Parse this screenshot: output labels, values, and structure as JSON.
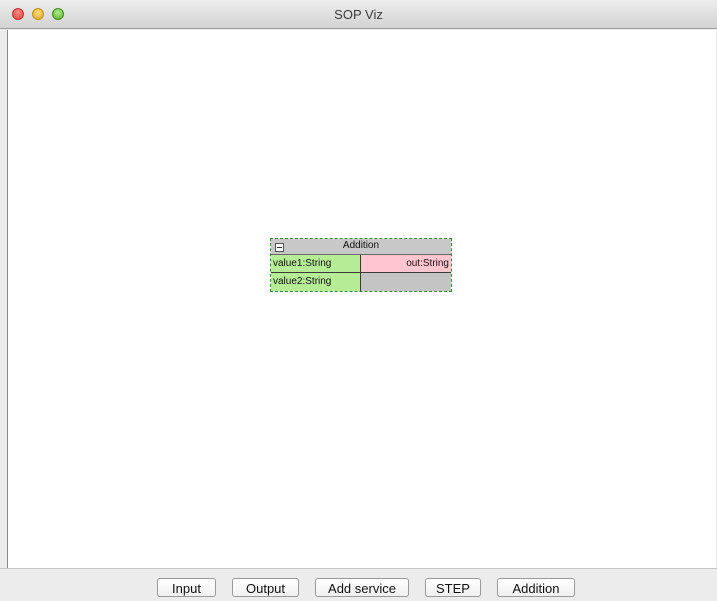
{
  "window": {
    "title": "SOP Viz"
  },
  "node": {
    "title": "Addition",
    "inputs": [
      "value1:String",
      "value2:String"
    ],
    "outputs": [
      "out:String"
    ]
  },
  "toolbar": {
    "buttons": [
      "Input",
      "Output",
      "Add service",
      "STEP",
      "Addition"
    ]
  },
  "colors": {
    "input_port": "#b7ec97",
    "output_port": "#ffc6cf",
    "node_header": "#c8c8c8"
  }
}
